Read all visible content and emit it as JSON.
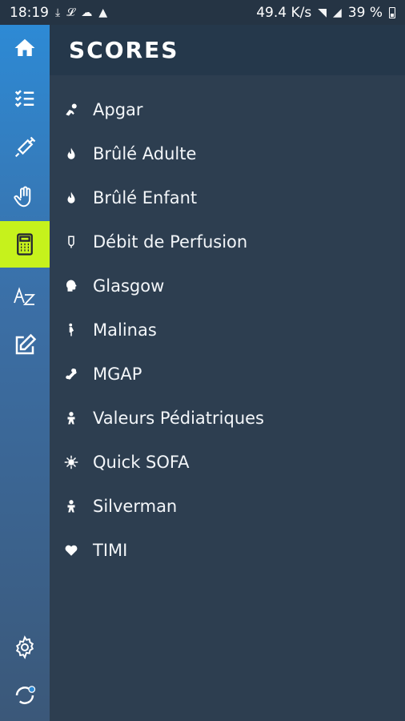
{
  "status": {
    "time": "18:19",
    "speed": "49.4 K/s",
    "battery": "39 %",
    "notification_icons": [
      "download-icon",
      "network-icon",
      "cloud-icon",
      "warning-icon"
    ]
  },
  "header": {
    "title": "SCORES"
  },
  "rail": {
    "items": [
      {
        "name": "home-icon"
      },
      {
        "name": "checklist-icon"
      },
      {
        "name": "syringe-icon"
      },
      {
        "name": "hand-icon"
      },
      {
        "name": "calculator-icon",
        "active": true
      },
      {
        "name": "az-icon"
      },
      {
        "name": "edit-icon"
      },
      {
        "name": "settings-icon"
      },
      {
        "name": "sync-icon"
      }
    ],
    "active_color": "#c6f21c"
  },
  "scores": [
    {
      "label": "Apgar",
      "icon": "newborn-icon"
    },
    {
      "label": "Brûlé Adulte",
      "icon": "flame-icon"
    },
    {
      "label": "Brûlé Enfant",
      "icon": "flame-icon"
    },
    {
      "label": "Débit de Perfusion",
      "icon": "drip-icon"
    },
    {
      "label": "Glasgow",
      "icon": "head-icon"
    },
    {
      "label": "Malinas",
      "icon": "pregnant-icon"
    },
    {
      "label": "MGAP",
      "icon": "bone-icon"
    },
    {
      "label": "Valeurs Pédiatriques",
      "icon": "baby-icon"
    },
    {
      "label": "Quick SOFA",
      "icon": "virus-icon"
    },
    {
      "label": "Silverman",
      "icon": "baby-icon"
    },
    {
      "label": "TIMI",
      "icon": "heart-icon"
    }
  ]
}
